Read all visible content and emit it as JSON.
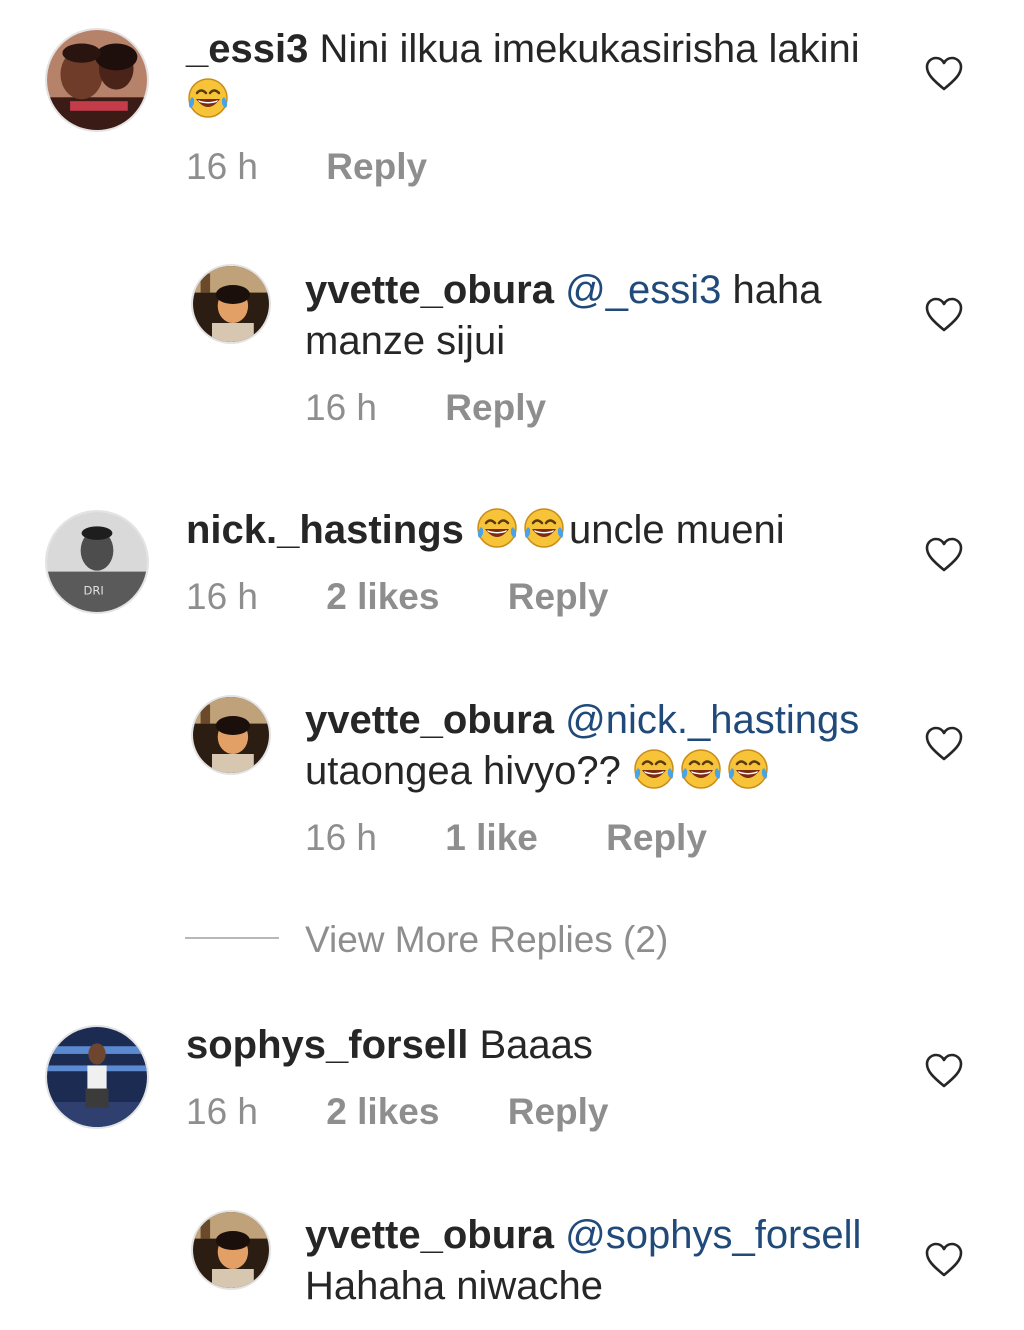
{
  "comments": [
    {
      "username": "_essi3",
      "body": " Nini ilkua imekukasirisha lakini",
      "time": "16 h",
      "likes": "",
      "reply_label": "Reply"
    },
    {
      "username": "yvette_obura",
      "mention": "@_essi3",
      "body": " haha manze sijui",
      "time": "16 h",
      "likes": "",
      "reply_label": "Reply"
    },
    {
      "username": "nick._hastings",
      "body": "uncle mueni",
      "time": "16 h",
      "likes": "2 likes",
      "reply_label": "Reply"
    },
    {
      "username": "yvette_obura",
      "mention": "@nick._hastings",
      "body": " utaongea hivyo??",
      "time": "16 h",
      "likes": "1 like",
      "reply_label": "Reply"
    },
    {
      "username": "sophys_forsell",
      "body": " Baaas",
      "time": "16 h",
      "likes": "2 likes",
      "reply_label": "Reply"
    },
    {
      "username": "yvette_obura",
      "mention": "@sophys_forsell",
      "body": " Hahaha niwache",
      "time": "",
      "likes": "",
      "reply_label": ""
    }
  ],
  "view_more_replies": "View More Replies (2)",
  "icons": {
    "like": "heart-outline-icon",
    "emoji": "face-with-tears-of-joy-icon"
  },
  "colors": {
    "text": "#262626",
    "secondary": "#8e8e8e",
    "mention": "#1f4a7a",
    "emoji_face": "#f7c339"
  }
}
